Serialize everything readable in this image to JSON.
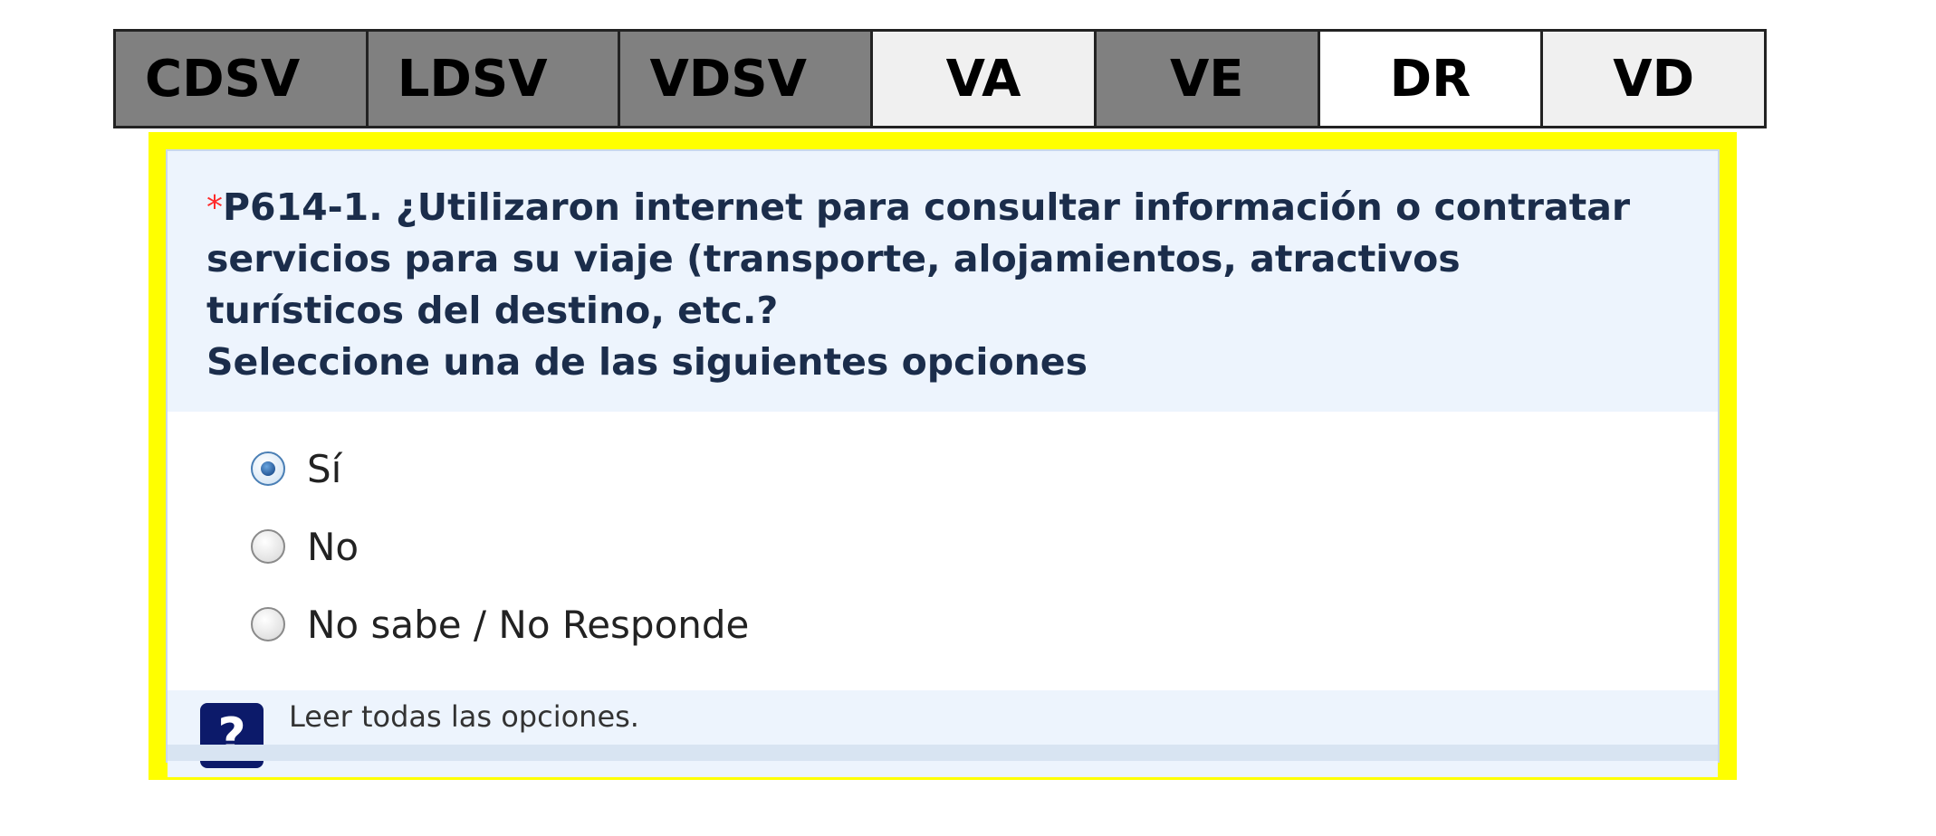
{
  "tabs": [
    {
      "label": "CDSV",
      "style": "dark"
    },
    {
      "label": "LDSV",
      "style": "dark"
    },
    {
      "label": "VDSV",
      "style": "dark"
    },
    {
      "label": "VA",
      "style": "light"
    },
    {
      "label": "VE",
      "style": "dark"
    },
    {
      "label": "DR",
      "style": "white"
    },
    {
      "label": "VD",
      "style": "light"
    }
  ],
  "question": {
    "required_marker": "*",
    "line1": "P614-1. ¿Utilizaron internet para consultar información o contratar",
    "line2": "servicios para su viaje (transporte, alojamientos, atractivos",
    "line3": "turísticos del destino, etc.?",
    "instruction": "Seleccione una de las siguientes opciones"
  },
  "options": [
    {
      "label": "Sí",
      "checked": true
    },
    {
      "label": "No",
      "checked": false
    },
    {
      "label": "No sabe / No Responde",
      "checked": false
    }
  ],
  "help": {
    "icon": "question-mark-icon",
    "icon_glyph": "?",
    "text": "Leer todas las opciones."
  },
  "colors": {
    "highlight_border": "#ffff00",
    "tab_dark": "#808080",
    "tab_light": "#f0f0f0",
    "required_marker": "#ff2a2a",
    "question_text": "#1b2d4b",
    "help_icon_bg": "#0c1a6a"
  }
}
